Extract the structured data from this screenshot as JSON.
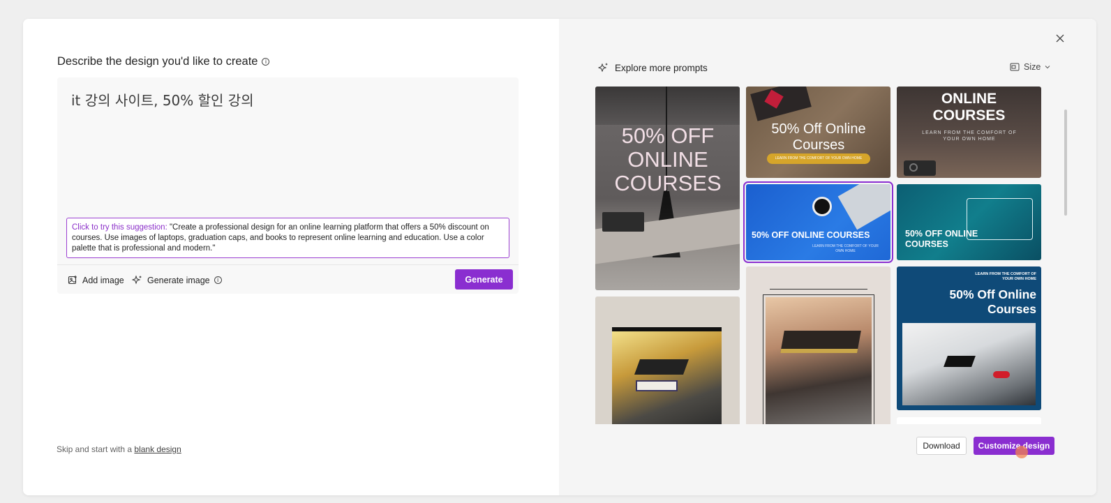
{
  "left_panel": {
    "title": "Describe the design you'd like to create",
    "prompt_value": "it 강의 사이트, 50% 할인 강의",
    "suggestion_lead": "Click to try this suggestion:",
    "suggestion_text": " \"Create a professional design for an online learning platform that offers a 50% discount on courses. Use images of laptops, graduation caps, and books to represent online learning and education. Use a color palette that is professional and modern.\"",
    "add_image_label": "Add image",
    "generate_image_label": "Generate image",
    "generate_button": "Generate",
    "skip_prefix": "Skip and start with a ",
    "skip_link": "blank design"
  },
  "right_panel": {
    "explore_label": "Explore more prompts",
    "size_label": "Size",
    "download_button": "Download",
    "customize_button": "Customize design"
  },
  "gallery": {
    "card1_text": "50% OFF ONLINE COURSES",
    "card2_title": "50% Off Online Courses",
    "card2_sub": "LEARN FROM THE COMFORT OF YOUR OWN HOME",
    "card3_title": "ONLINE COURSES",
    "card3_sub": "LEARN FROM THE COMFORT OF YOUR OWN HOME",
    "card4_title": "50% OFF ONLINE COURSES",
    "card4_sub": "LEARN FROM THE COMFORT OF YOUR OWN HOME",
    "card5_title": "50% OFF ONLINE COURSES",
    "card8_sub": "LEARN FROM THE COMFORT OF YOUR OWN HOME",
    "card8_title": "50% Off Online Courses"
  },
  "colors": {
    "accent": "#8a2ed0",
    "right_bg": "#f5f5f5"
  }
}
